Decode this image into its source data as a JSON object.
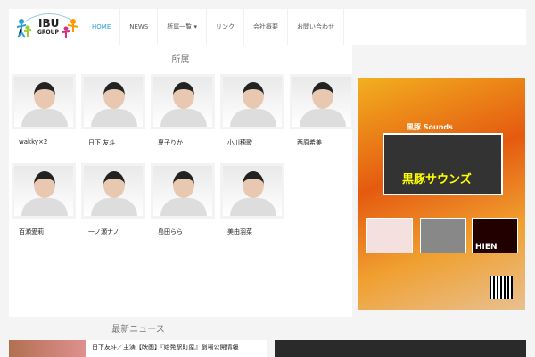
{
  "logo": {
    "line1": "IBU",
    "line2": "GROUP"
  },
  "nav": [
    {
      "label": "HOME",
      "active": true
    },
    {
      "label": "NEWS"
    },
    {
      "label": "所属一覧 ▾"
    },
    {
      "label": "リンク"
    },
    {
      "label": "会社概要"
    },
    {
      "label": "お問い合わせ"
    }
  ],
  "section_title": "所属",
  "members": [
    "wakky×2",
    "日下 友斗",
    "夏子りか",
    "小川穂歌",
    "西原希美",
    "百瀬愛莉",
    "一ノ瀬ナノ",
    "島田らら",
    "美由羽菜"
  ],
  "poster": {
    "label": "黒豚 Sounds",
    "band": "黒豚サウンズ",
    "logo": "HIEN"
  },
  "news_title": "最新ニュース",
  "news": [
    {
      "title": "日下友斗／主演【映画】『始発駅町屋』劇場公開情報"
    }
  ],
  "colors": {
    "accent": "#2a9fd6"
  }
}
